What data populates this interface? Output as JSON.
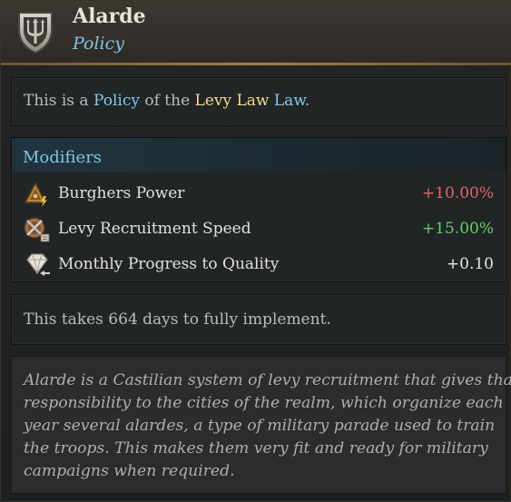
{
  "header": {
    "title": "Alarde",
    "subtitle": "Policy",
    "emblem_icon": "shield-trident-icon"
  },
  "intro": {
    "prefix": "This is a ",
    "policy_word": "Policy",
    "middle": " of the ",
    "law_name": "Levy Law",
    "law_word": "Law",
    "suffix": "."
  },
  "modifiers": {
    "title": "Modifiers",
    "items": [
      {
        "icon": "burghers-power-icon",
        "label": "Burghers Power",
        "value": "+10.00%",
        "color": "#e0666c"
      },
      {
        "icon": "levy-recruitment-icon",
        "label": "Levy Recruitment Speed",
        "value": "+15.00%",
        "color": "#63d066"
      },
      {
        "icon": "quality-gem-icon",
        "label": "Monthly Progress to Quality",
        "value": "+0.10",
        "color": "#e6e4dd"
      }
    ]
  },
  "implementation": {
    "text": "This takes 664 days to fully implement."
  },
  "flavor": {
    "lines": [
      "Alarde is a Castilian system of levy recruitment that gives that",
      "responsibility to the cities of the realm, which organize each",
      "year several alardes, a type of military parade used to train",
      "the troops. This makes them very fit and ready for military",
      "campaigns when required."
    ]
  }
}
